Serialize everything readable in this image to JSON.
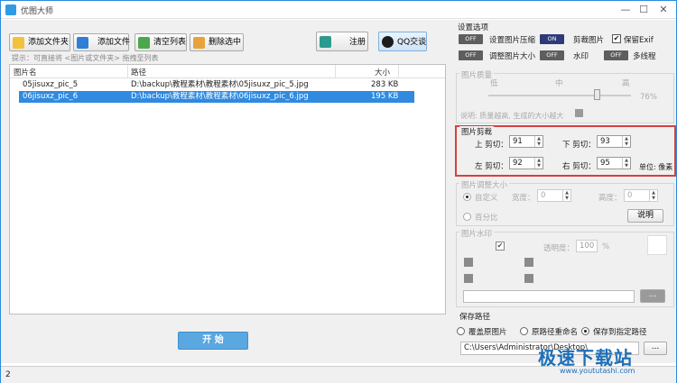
{
  "window": {
    "title": "优图大师",
    "min": "—",
    "max": "☐",
    "close": "✕"
  },
  "toolbar": {
    "add_folder": "添加文件夹",
    "add_file": "添加文件",
    "clear_list": "清空列表",
    "delete_selected": "删除选中",
    "register": "注册",
    "qq": "QQ交谈",
    "hint": "提示：可直接将 <图片或文件夹> 拖拽至列表"
  },
  "filelist": {
    "headers": [
      "图片名",
      "路径",
      "大小"
    ],
    "rows": [
      {
        "name": "05jisuxz_pic_5",
        "path": "D:\\backup\\教程素材\\教程素材\\05jisuxz_pic_5.jpg",
        "size": "283 KB"
      },
      {
        "name": "06jisuxz_pic_6",
        "path": "D:\\backup\\教程素材\\教程素材\\06jisuxz_pic_6.jpg",
        "size": "195 KB"
      }
    ]
  },
  "start_label": "开 始",
  "settings": {
    "title": "设置选项",
    "compress": {
      "state": "OFF",
      "label": "设置图片压缩"
    },
    "crop": {
      "state": "ON",
      "label": "剪裁图片"
    },
    "keep_exif": "保留Exif",
    "resize": {
      "state": "OFF",
      "label": "调整图片大小"
    },
    "watermark": {
      "state": "OFF",
      "label": "水印"
    },
    "multithread": {
      "state": "OFF",
      "label": "多线程"
    }
  },
  "quality": {
    "title": "图片质量",
    "low": "低",
    "mid": "中",
    "high": "高",
    "percent": "76%",
    "level": 0.76,
    "note": "说明: 质量越高, 生成的大小越大"
  },
  "cropping": {
    "title": "图片剪裁",
    "top_label": "上 剪切：",
    "top": "91",
    "bottom_label": "下 剪切：",
    "bottom": "93",
    "left_label": "左 剪切：",
    "left": "92",
    "right_label": "右 剪切：",
    "right": "95",
    "unit": "单位: 像素"
  },
  "resize": {
    "title": "图片调整大小",
    "custom": "自定义",
    "width_label": "宽度：",
    "width": "0",
    "height_label": "高度：",
    "height": "0",
    "percent": "百分比",
    "help": "说明"
  },
  "wm": {
    "title": "图片水印",
    "transparency_label": "透明度：",
    "transparency": "100",
    "percent_sign": "%",
    "browse": "..."
  },
  "save": {
    "title": "保存路径",
    "overwrite": "覆盖原图片",
    "rename": "原路径重命名",
    "specified": "保存到指定路径",
    "path": "C:\\Users\\Administrator\\Desktop\\",
    "browse": "..."
  },
  "status": {
    "count": "2"
  },
  "brand": {
    "text": "极速下载站",
    "url": "www.yoututashi.com"
  }
}
